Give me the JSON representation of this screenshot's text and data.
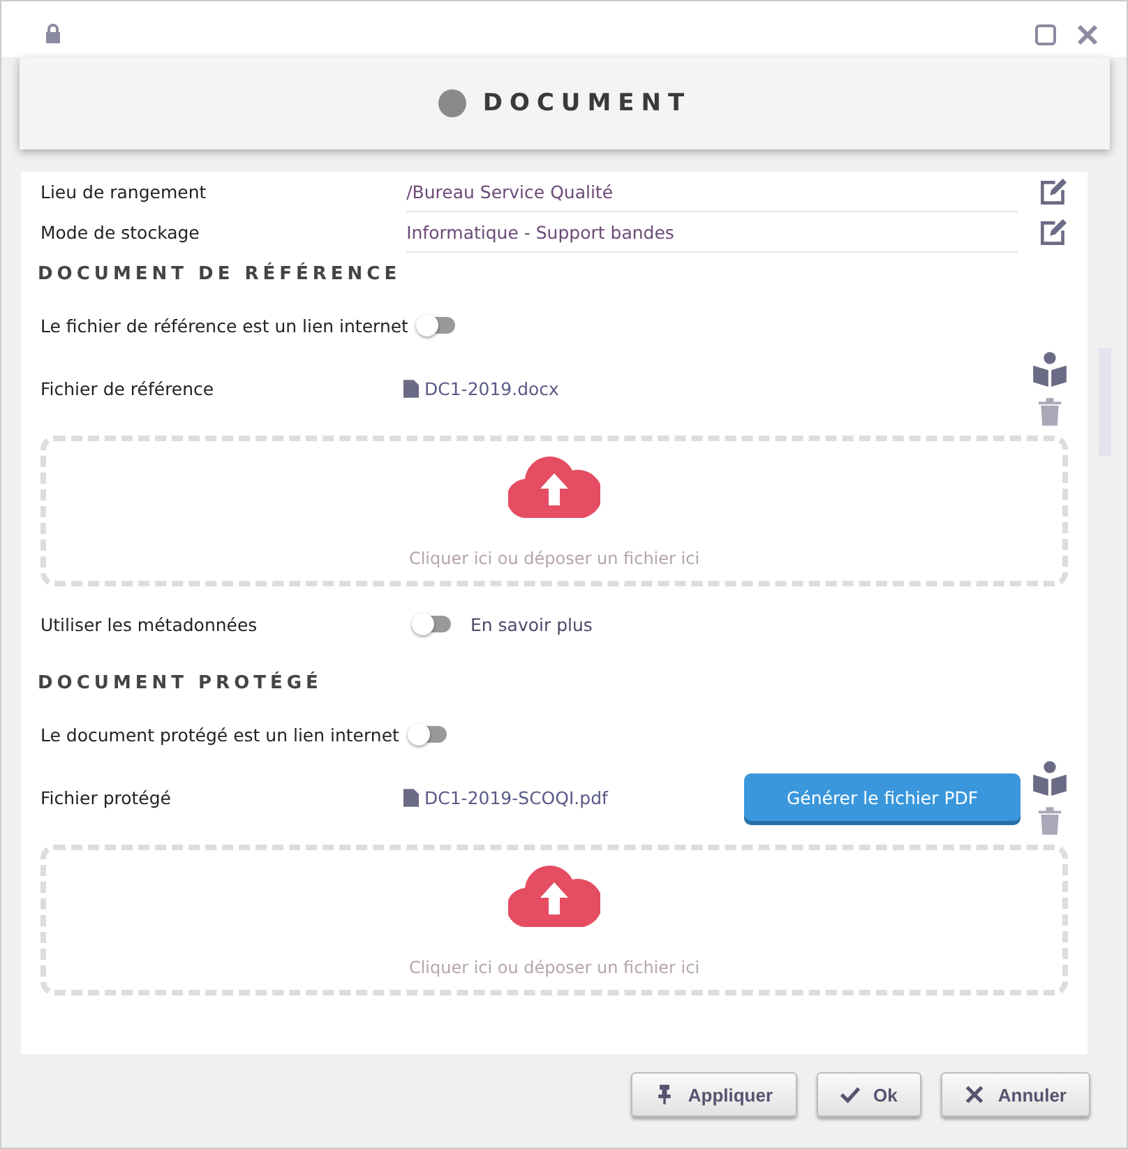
{
  "window": {
    "title": "DOCUMENT"
  },
  "fields": [
    {
      "label": "Lieu de rangement",
      "value": "/Bureau Service Qualité"
    },
    {
      "label": "Mode de stockage",
      "value": "Informatique - Support bandes"
    }
  ],
  "sections": [
    {
      "title": "DOCUMENT DE RÉFÉRENCE",
      "toggles": [
        {
          "label": "Le fichier de référence est un lien internet",
          "on": false
        }
      ],
      "file": {
        "label": "Fichier de référence",
        "name": "DC1-2019.docx"
      },
      "dropzone": "Cliquer ici ou déposer un fichier ici",
      "metadata": {
        "label": "Utiliser les métadonnées",
        "on": false,
        "link": "En savoir plus"
      }
    },
    {
      "title": "DOCUMENT PROTÉGÉ",
      "toggles": [
        {
          "label": "Le document protégé est un lien internet",
          "on": false
        }
      ],
      "file": {
        "label": "Fichier protégé",
        "name": "DC1-2019-SCOQI.pdf"
      },
      "generate_button": "Générer le fichier PDF",
      "dropzone": "Cliquer ici ou déposer un fichier ici"
    }
  ],
  "buttons": [
    {
      "label": "Appliquer",
      "kind": "apply"
    },
    {
      "label": "Ok",
      "kind": "ok"
    },
    {
      "label": "Annuler",
      "kind": "cancel"
    }
  ]
}
